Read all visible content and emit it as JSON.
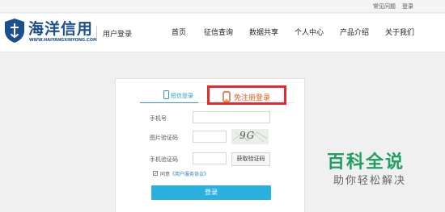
{
  "topbar": {
    "faq": "常见问题",
    "login": "登录"
  },
  "header": {
    "logo_text": "海洋信用",
    "logo_url": "WWW.HAIYANGXINYONG.COM",
    "subtitle": "用户登录",
    "nav": [
      "首页",
      "征信查询",
      "数据共享",
      "个人中心",
      "产品介绍",
      "关于我们"
    ]
  },
  "login": {
    "tab_sms": "短信登录",
    "tab_free": "免注册登录",
    "phone_label": "手机号",
    "captcha_label": "图片验证码",
    "captcha_text": "9G",
    "sms_label": "手机验证码",
    "sms_button": "获取验证码",
    "agree_prefix": "同意",
    "agree_link": "《用户服务协议》",
    "submit": "登录"
  },
  "watermark": {
    "title": "百科全说",
    "subtitle": "助你轻松解决"
  },
  "colors": {
    "accent": "#2cb0e0",
    "highlight": "#e8282d",
    "brand": "#1b4f8f"
  }
}
